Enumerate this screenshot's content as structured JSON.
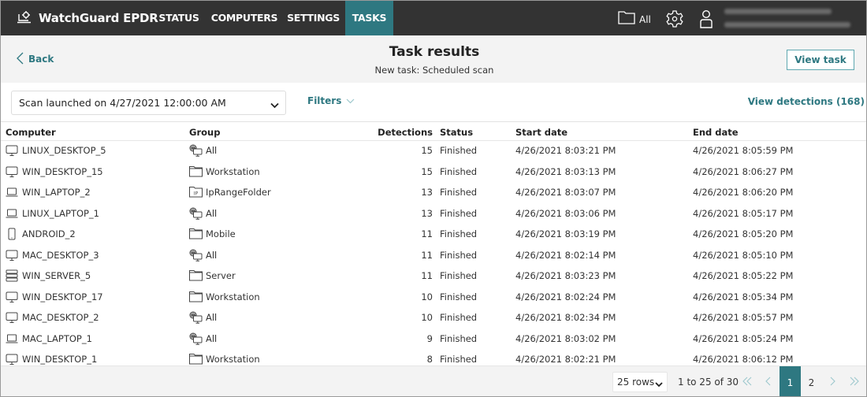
{
  "app": {
    "brand": "WatchGuard EPDR",
    "nav": [
      {
        "label": "STATUS",
        "active": false
      },
      {
        "label": "COMPUTERS",
        "active": false
      },
      {
        "label": "SETTINGS",
        "active": false
      },
      {
        "label": "TASKS",
        "active": true
      }
    ],
    "folder_filter_label": "All",
    "icons": {
      "logo": "laptop-crosshair-icon",
      "folder": "folder-icon",
      "settings": "gear-icon",
      "user": "user-icon"
    }
  },
  "header": {
    "back_label": "Back",
    "title": "Task results",
    "subtitle": "New task: Scheduled scan",
    "view_task_label": "View task"
  },
  "toolbar": {
    "scan_select_value": "Scan launched on 4/27/2021 12:00:00 AM",
    "filters_label": "Filters",
    "view_detections_label": "View detections (168)"
  },
  "table": {
    "columns": [
      "Computer",
      "Group",
      "Detections",
      "Status",
      "Start date",
      "End date"
    ],
    "rows": [
      {
        "computer": "LINUX_DESKTOP_5",
        "device_icon": "desktop",
        "group": "All",
        "group_icon": "all-groups",
        "detections": "15",
        "status": "Finished",
        "start": "4/26/2021 8:03:21 PM",
        "end": "4/26/2021 8:05:59 PM"
      },
      {
        "computer": "WIN_DESKTOP_15",
        "device_icon": "desktop",
        "group": "Workstation",
        "group_icon": "folder",
        "detections": "15",
        "status": "Finished",
        "start": "4/26/2021 8:03:13 PM",
        "end": "4/26/2021 8:06:27 PM"
      },
      {
        "computer": "WIN_LAPTOP_2",
        "device_icon": "laptop",
        "group": "IpRangeFolder",
        "group_icon": "ip-folder",
        "detections": "13",
        "status": "Finished",
        "start": "4/26/2021 8:03:07 PM",
        "end": "4/26/2021 8:06:20 PM"
      },
      {
        "computer": "LINUX_LAPTOP_1",
        "device_icon": "laptop",
        "group": "All",
        "group_icon": "all-groups",
        "detections": "13",
        "status": "Finished",
        "start": "4/26/2021 8:03:06 PM",
        "end": "4/26/2021 8:05:17 PM"
      },
      {
        "computer": "ANDROID_2",
        "device_icon": "mobile",
        "group": "Mobile",
        "group_icon": "folder",
        "detections": "11",
        "status": "Finished",
        "start": "4/26/2021 8:03:19 PM",
        "end": "4/26/2021 8:05:20 PM"
      },
      {
        "computer": "MAC_DESKTOP_3",
        "device_icon": "desktop",
        "group": "All",
        "group_icon": "all-groups",
        "detections": "11",
        "status": "Finished",
        "start": "4/26/2021 8:02:14 PM",
        "end": "4/26/2021 8:05:10 PM"
      },
      {
        "computer": "WIN_SERVER_5",
        "device_icon": "server",
        "group": "Server",
        "group_icon": "folder",
        "detections": "11",
        "status": "Finished",
        "start": "4/26/2021 8:03:23 PM",
        "end": "4/26/2021 8:05:22 PM"
      },
      {
        "computer": "WIN_DESKTOP_17",
        "device_icon": "desktop",
        "group": "Workstation",
        "group_icon": "folder",
        "detections": "10",
        "status": "Finished",
        "start": "4/26/2021 8:02:24 PM",
        "end": "4/26/2021 8:05:34 PM"
      },
      {
        "computer": "MAC_DESKTOP_2",
        "device_icon": "desktop",
        "group": "All",
        "group_icon": "all-groups",
        "detections": "10",
        "status": "Finished",
        "start": "4/26/2021 8:02:34 PM",
        "end": "4/26/2021 8:05:57 PM"
      },
      {
        "computer": "MAC_LAPTOP_1",
        "device_icon": "laptop",
        "group": "All",
        "group_icon": "all-groups",
        "detections": "9",
        "status": "Finished",
        "start": "4/26/2021 8:03:02 PM",
        "end": "4/26/2021 8:05:24 PM"
      },
      {
        "computer": "WIN_DESKTOP_1",
        "device_icon": "desktop",
        "group": "Workstation",
        "group_icon": "folder",
        "detections": "8",
        "status": "Finished",
        "start": "4/26/2021 8:02:21 PM",
        "end": "4/26/2021 8:06:12 PM"
      }
    ]
  },
  "pagination": {
    "rows_per_page": "25 rows",
    "range_text": "1 to 25 of 30",
    "pages": [
      "1",
      "2"
    ],
    "current_page": "1"
  },
  "colors": {
    "topbar": "#333333",
    "accent": "#2e7881",
    "header_band": "#f3f3f3"
  }
}
